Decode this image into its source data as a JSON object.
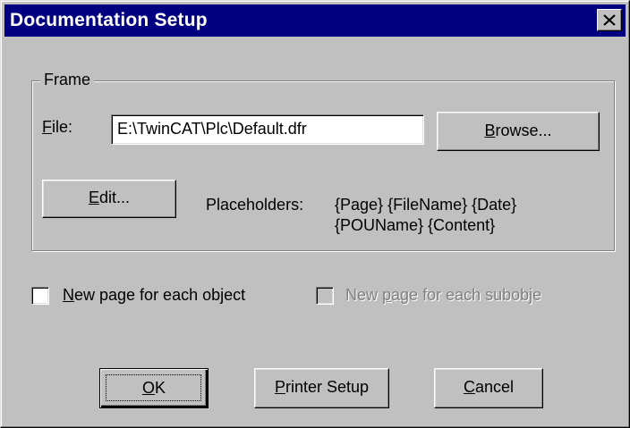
{
  "window": {
    "title": "Documentation Setup"
  },
  "frame": {
    "group_label": "Frame",
    "file_label_mnemonic": "F",
    "file_label_rest": "ile:",
    "file_value": "E:\\TwinCAT\\Plc\\Default.dfr",
    "browse_mnemonic": "B",
    "browse_rest": "rowse...",
    "edit_mnemonic": "E",
    "edit_rest": "dit...",
    "placeholders_label": "Placeholders:",
    "placeholders_line1": "{Page} {FileName} {Date}",
    "placeholders_line2": "{POUName} {Content}"
  },
  "options": {
    "new_page_object_mnemonic": "N",
    "new_page_object_rest": "ew page for each object",
    "new_page_object_checked": false,
    "new_page_subobject_label_pre": "New ",
    "new_page_subobject_mnemonic": "p",
    "new_page_subobject_rest": "age for each subobje",
    "new_page_subobject_checked": false,
    "new_page_subobject_enabled": false
  },
  "buttons": {
    "ok_mnemonic": "O",
    "ok_rest": "K",
    "printer_setup_mnemonic": "P",
    "printer_setup_rest": "rinter Setup",
    "cancel_mnemonic": "C",
    "cancel_rest": "ancel"
  },
  "colors": {
    "title_bar": "#000080",
    "dialog_face": "#c0c0c0",
    "disabled_text": "#808080"
  },
  "icons": {
    "close": "close-icon"
  }
}
